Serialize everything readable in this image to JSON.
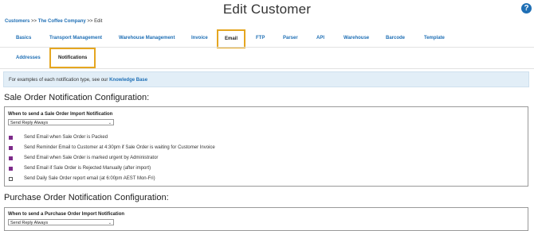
{
  "page_title": "Edit Customer",
  "help_symbol": "?",
  "breadcrumb": {
    "root": "Customers",
    "sep1": ">>",
    "company": "The Coffee Company",
    "sep2": ">>",
    "current": "Edit"
  },
  "main_tabs": [
    "Basics",
    "Transport Management",
    "Warehouse Management",
    "Invoice",
    "Email",
    "FTP",
    "Parser",
    "API",
    "Warehouse",
    "Barcode",
    "Template"
  ],
  "active_main_tab": "Email",
  "sub_tabs": [
    "Addresses",
    "Notifications"
  ],
  "active_sub_tab": "Notifications",
  "info": {
    "text": "For examples of each notification type, see our",
    "link": "Knowledge Base"
  },
  "sale_order": {
    "heading": "Sale Order Notification Configuration:",
    "import_label": "When to send a Sale Order Import Notification",
    "import_value": "Send Reply Always",
    "options": [
      {
        "label": "Send Email when Sale Order is Packed",
        "checked": true
      },
      {
        "label": "Send Reminder Email to Customer at 4:30pm if Sale Order is waiting for Customer Invoice",
        "checked": true
      },
      {
        "label": "Send Email when Sale Order is marked urgent by Administrator",
        "checked": true
      },
      {
        "label": "Send Email if Sale Order is Rejected Manually (after import)",
        "checked": true
      },
      {
        "label": "Send Daily Sale Order report email (at 6:00pm AEST Mon-Fri)",
        "checked": false
      }
    ]
  },
  "purchase_order": {
    "heading": "Purchase Order Notification Configuration:",
    "import_label": "When to send a Purchase Order Import Notification",
    "import_value": "Send Reply Always"
  },
  "colors": {
    "link": "#1f6fb5",
    "active_tab_border": "#e5a620",
    "info_bg": "#e2eef7",
    "checkbox": "#7d2a8a"
  }
}
